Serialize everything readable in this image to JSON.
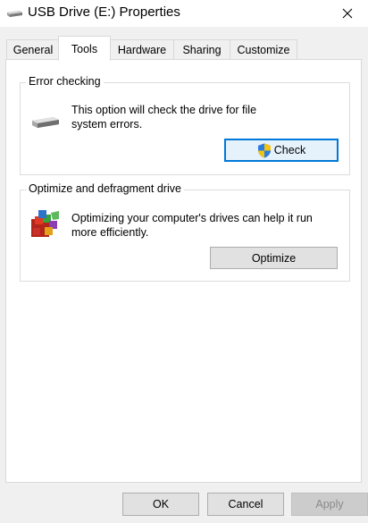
{
  "window": {
    "title": "USB Drive (E:) Properties",
    "close_icon": "close-icon"
  },
  "tabs": [
    {
      "label": "General",
      "active": false
    },
    {
      "label": "Tools",
      "active": true
    },
    {
      "label": "Hardware",
      "active": false
    },
    {
      "label": "Sharing",
      "active": false
    },
    {
      "label": "Customize",
      "active": false
    }
  ],
  "error_checking": {
    "title": "Error checking",
    "description_line1": "This option will check the drive for file",
    "description_line2": "system errors.",
    "button_label": "Check",
    "icon": "drive-icon",
    "button_icon": "uac-shield-icon"
  },
  "optimize": {
    "title": "Optimize and defragment drive",
    "description_line1": "Optimizing your computer's drives can help it run",
    "description_line2": "more efficiently.",
    "button_label": "Optimize",
    "icon": "defrag-icon"
  },
  "footer": {
    "ok_label": "OK",
    "cancel_label": "Cancel",
    "apply_label": "Apply"
  },
  "colors": {
    "focus_border": "#0078d7",
    "dialog_bg": "#f0f0f0",
    "panel_bg": "#ffffff"
  }
}
